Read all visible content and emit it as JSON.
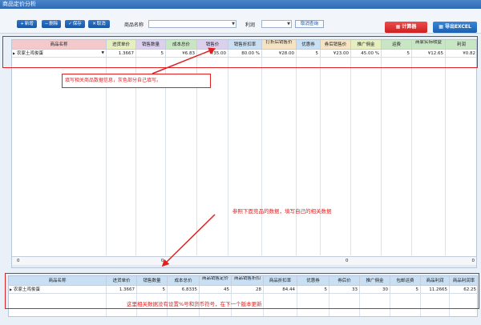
{
  "window": {
    "title": "商品定价分析"
  },
  "toolbar": {
    "add_label": "新增",
    "delete_label": "删除",
    "save_label": "保存",
    "cancel_label": "取消",
    "product_name_label": "商品名称",
    "product_name_value": "",
    "profit_label": "利润",
    "profit_value": "",
    "query_label": "取消查询",
    "calculator_label": "计算器",
    "export_label": "导出EXCEL"
  },
  "grid1": {
    "headers": [
      {
        "label": "商品名称",
        "color": "#f3c9cc"
      },
      {
        "label": "进货单价",
        "color": "#e6efbf"
      },
      {
        "label": "销售数量",
        "color": "#dcd0ef"
      },
      {
        "label": "成本总价",
        "color": "#c9e6c4"
      },
      {
        "label": "销售价",
        "color": "#dcd0ef"
      },
      {
        "label": "销售折扣率",
        "color": "#c9dff3"
      },
      {
        "label": "打折后销售价",
        "color": "#f6e3c3"
      },
      {
        "label": "优惠券",
        "color": "#c9dff3"
      },
      {
        "label": "券后销售价",
        "color": "#f6e3c3"
      },
      {
        "label": "推广佣金",
        "color": "#e6efbf"
      },
      {
        "label": "运费",
        "color": "#c9e6c4"
      },
      {
        "label": "商家实际收益",
        "color": "#c9e6c4"
      },
      {
        "label": "利润",
        "color": "#c9e6c4"
      }
    ],
    "row": [
      "农家土鸡俊蛋",
      "1.3667",
      "5",
      "¥6.83",
      "¥35.00",
      "80.00 %",
      "¥28.00",
      "5",
      "¥23.00",
      "45.00 %",
      "5",
      "¥12.65",
      "¥0.82"
    ],
    "footer": [
      "0",
      "",
      "0",
      "",
      "",
      "",
      "",
      "",
      "0",
      "",
      "",
      "",
      "0"
    ]
  },
  "grid2": {
    "headers": [
      {
        "label": "商品名称",
        "color": "#c9dff3"
      },
      {
        "label": "进货单价",
        "color": "#c9dff3"
      },
      {
        "label": "销售数量",
        "color": "#c9dff3"
      },
      {
        "label": "成本总价",
        "color": "#c9dff3"
      },
      {
        "label": "商品销售定价",
        "color": "#c9dff3"
      },
      {
        "label": "商品销售折扣",
        "color": "#c9dff3"
      },
      {
        "label": "商品折扣率",
        "color": "#c9dff3"
      },
      {
        "label": "优惠券",
        "color": "#c9dff3"
      },
      {
        "label": "券后价",
        "color": "#c9dff3"
      },
      {
        "label": "推广佣金",
        "color": "#c9dff3"
      },
      {
        "label": "包邮运费",
        "color": "#c9dff3"
      },
      {
        "label": "商品利润",
        "color": "#c9dff3"
      },
      {
        "label": "商品利润率",
        "color": "#c9dff3"
      }
    ],
    "row": [
      "农家土鸡俊蛋",
      "1.3667",
      "5",
      "6.8335",
      "45",
      "28",
      "84.44",
      "5",
      "33",
      "30",
      "5",
      "11.2665",
      "62.25"
    ]
  },
  "notes": {
    "note1": "填写相关商品数据信息，灰色部分自己填写。",
    "note2": "参照下面竞品的数据，填写自己的相关数据",
    "note3": "这里相关数据没有设置%号和货币符号，在下一个版本更新"
  },
  "colors": {
    "accent": "#2f74c9",
    "annotation": "#e02020"
  }
}
